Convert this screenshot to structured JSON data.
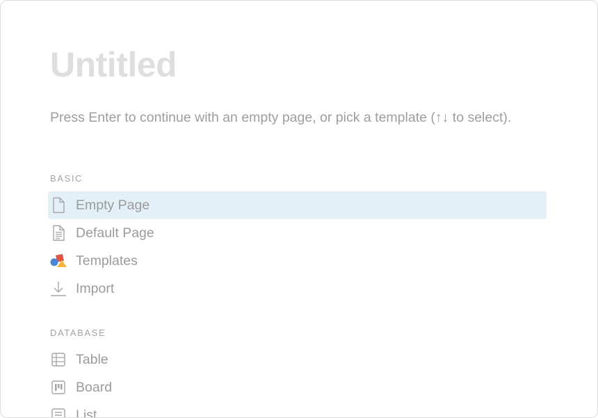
{
  "page": {
    "title": "Untitled",
    "hint": "Press Enter to continue with an empty page, or pick a template (↑↓ to select)."
  },
  "sections": [
    {
      "label": "BASIC",
      "items": [
        {
          "label": "Empty Page",
          "icon": "empty-page-icon",
          "selected": true
        },
        {
          "label": "Default Page",
          "icon": "default-page-icon",
          "selected": false
        },
        {
          "label": "Templates",
          "icon": "templates-icon",
          "selected": false
        },
        {
          "label": "Import",
          "icon": "import-icon",
          "selected": false
        }
      ]
    },
    {
      "label": "DATABASE",
      "items": [
        {
          "label": "Table",
          "icon": "table-icon",
          "selected": false
        },
        {
          "label": "Board",
          "icon": "board-icon",
          "selected": false
        },
        {
          "label": "List",
          "icon": "list-icon",
          "selected": false
        }
      ]
    }
  ],
  "colors": {
    "selected_background": "#e4f0f8",
    "title_text": "#dedede",
    "muted_text": "#9b9b9b",
    "templates_red": "#e15546",
    "templates_blue": "#4a87d3",
    "templates_yellow": "#f2b53a"
  }
}
